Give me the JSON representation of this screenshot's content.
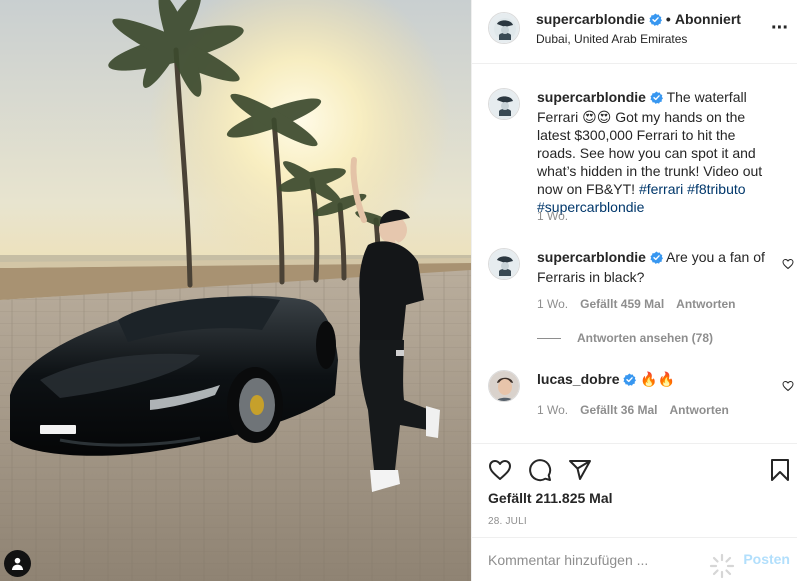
{
  "post": {
    "username": "supercarblondie",
    "follow_status": "Abonniert",
    "location": "Dubai, United Arab Emirates",
    "more_icon": "more-horizontal-icon",
    "verified_color": "#3897f0"
  },
  "caption": {
    "username": "supercarblondie",
    "text": "The waterfall Ferrari 😍😍 Got my hands on the latest $300,000 Ferrari to hit the roads. See how you can spot it and what’s hidden in the trunk! Video out now on FB&YT!",
    "hashtags": "#ferrari #f8tributo #supercarblondie",
    "age": "1 Wo."
  },
  "comments": [
    {
      "username": "supercarblondie",
      "text": "Are you a fan of Ferraris in black?",
      "age": "1 Wo.",
      "likes": "Gefällt 459 Mal",
      "reply": "Antworten",
      "view_replies": "Antworten ansehen (78)"
    },
    {
      "username": "lucas_dobre",
      "text": "🔥🔥",
      "age": "1 Wo.",
      "likes": "Gefällt 36 Mal",
      "reply": "Antworten"
    }
  ],
  "actions": {
    "like_icon": "heart-icon",
    "comment_icon": "comment-icon",
    "share_icon": "share-icon",
    "save_icon": "bookmark-icon",
    "likes": "Gefällt 211.825 Mal",
    "date": "28. JULI"
  },
  "composer": {
    "placeholder": "Kommentar hinzufügen ...",
    "post_label": "Posten",
    "post_color": "#b2dffc"
  },
  "colors": {
    "text": "#262626",
    "secondary": "#8e8e8e",
    "link": "#00376b",
    "border": "#efefef"
  }
}
